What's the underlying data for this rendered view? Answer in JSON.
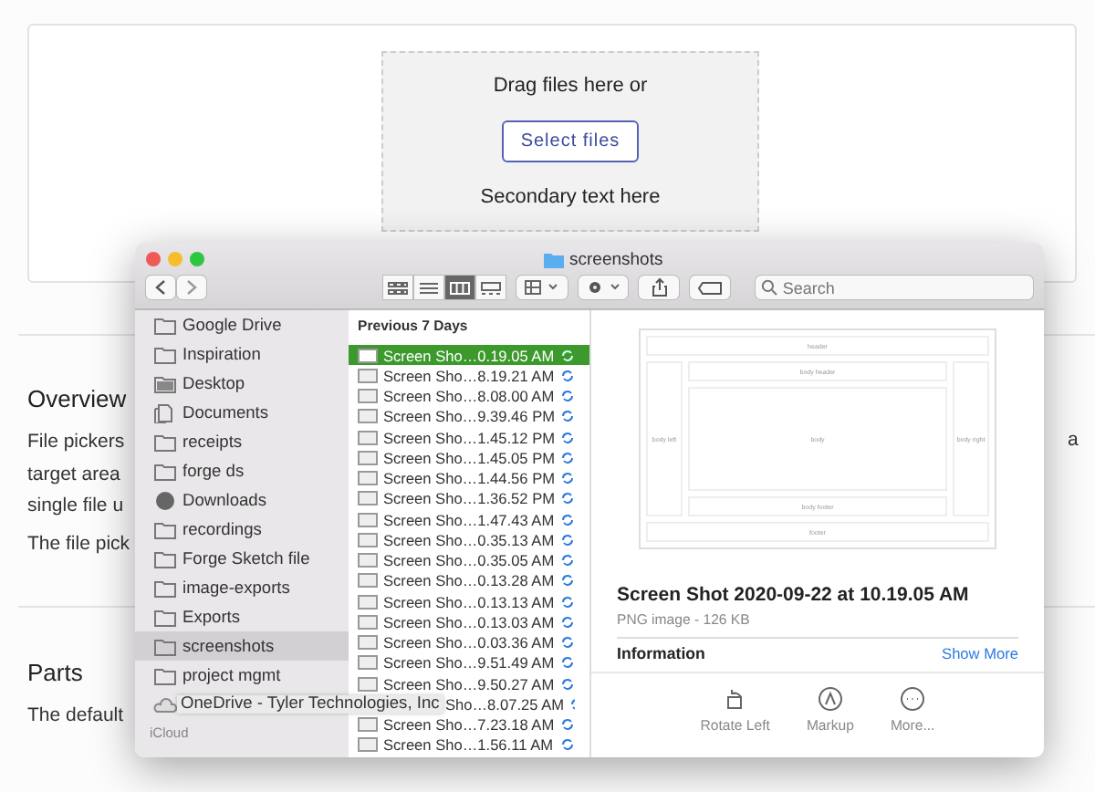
{
  "dropzone": {
    "prompt": "Drag files here or",
    "button": "Select files",
    "secondary": "Secondary text here"
  },
  "overview": {
    "heading": "Overview",
    "lines": [
      "File pickers",
      "target area",
      "single file u"
    ],
    "trailing": "a",
    "paragraph2": "The file pick"
  },
  "parts": {
    "heading": "Parts",
    "line": "The default"
  },
  "finder": {
    "title": "screenshots",
    "search": {
      "placeholder": "Search"
    },
    "views": [
      {
        "kind": "icons",
        "selected": false
      },
      {
        "kind": "list",
        "selected": false
      },
      {
        "kind": "columns",
        "selected": true
      },
      {
        "kind": "gallery",
        "selected": false
      }
    ],
    "sidebar": [
      {
        "label": "Google Drive",
        "kind": "folder",
        "selected": false
      },
      {
        "label": "Inspiration",
        "kind": "folder",
        "selected": false
      },
      {
        "label": "Desktop",
        "kind": "desktop",
        "selected": false
      },
      {
        "label": "Documents",
        "kind": "documents",
        "selected": false
      },
      {
        "label": "receipts",
        "kind": "folder",
        "selected": false
      },
      {
        "label": "forge ds",
        "kind": "folder",
        "selected": false
      },
      {
        "label": "Downloads",
        "kind": "download",
        "selected": false
      },
      {
        "label": "recordings",
        "kind": "folder",
        "selected": false
      },
      {
        "label": "Forge Sketch file",
        "kind": "folder",
        "selected": false
      },
      {
        "label": "image-exports",
        "kind": "folder",
        "selected": false
      },
      {
        "label": "Exports",
        "kind": "folder",
        "selected": false
      },
      {
        "label": "screenshots",
        "kind": "folder",
        "selected": true
      },
      {
        "label": "project mgmt",
        "kind": "folder",
        "selected": false
      },
      {
        "label": "OneDrive - Tyler Technologies, Inc",
        "kind": "cloud",
        "selected": false
      }
    ],
    "sidebar_section": "iCloud",
    "files": {
      "header": "Previous 7 Days",
      "rows": [
        {
          "name": "Screen Sho…0.19.05 AM",
          "selected": true
        },
        {
          "name": "Screen Sho…8.19.21 AM",
          "selected": false
        },
        {
          "name": "Screen Sho…8.08.00 AM",
          "selected": false
        },
        {
          "name": "Screen Sho…9.39.46 PM",
          "selected": false
        },
        {
          "name": "Screen Sho…1.45.12 PM",
          "selected": false
        },
        {
          "name": "Screen Sho…1.45.05 PM",
          "selected": false
        },
        {
          "name": "Screen Sho…1.44.56 PM",
          "selected": false
        },
        {
          "name": "Screen Sho…1.36.52 PM",
          "selected": false
        },
        {
          "name": "Screen Sho…1.47.43 AM",
          "selected": false
        },
        {
          "name": "Screen Sho…0.35.13 AM",
          "selected": false
        },
        {
          "name": "Screen Sho…0.35.05 AM",
          "selected": false
        },
        {
          "name": "Screen Sho…0.13.28 AM",
          "selected": false
        },
        {
          "name": "Screen Sho…0.13.13 AM",
          "selected": false
        },
        {
          "name": "Screen Sho…0.13.03 AM",
          "selected": false
        },
        {
          "name": "Screen Sho…0.03.36 AM",
          "selected": false
        },
        {
          "name": "Screen Sho…9.51.49 AM",
          "selected": false
        },
        {
          "name": "Screen Sho…9.50.27 AM",
          "selected": false
        },
        {
          "name": "Sho…8.07.25 AM",
          "selected": false,
          "partial": true
        },
        {
          "name": "Screen Sho…7.23.18 AM",
          "selected": false
        },
        {
          "name": "Screen Sho…1.56.11 AM",
          "selected": false
        }
      ]
    },
    "preview": {
      "thumbnail": {
        "header": "header",
        "body_header": "body header",
        "body_left": "body left",
        "body": "body",
        "body_right": "body right",
        "body_footer": "body footer",
        "footer": "footer"
      },
      "title": "Screen Shot 2020-09-22 at 10.19.05 AM",
      "subtitle": "PNG image - 126 KB",
      "section": "Information",
      "section_link": "Show More",
      "actions": [
        {
          "label": "Rotate Left",
          "kind": "rotate"
        },
        {
          "label": "Markup",
          "kind": "markup"
        },
        {
          "label": "More...",
          "kind": "more"
        }
      ]
    }
  }
}
